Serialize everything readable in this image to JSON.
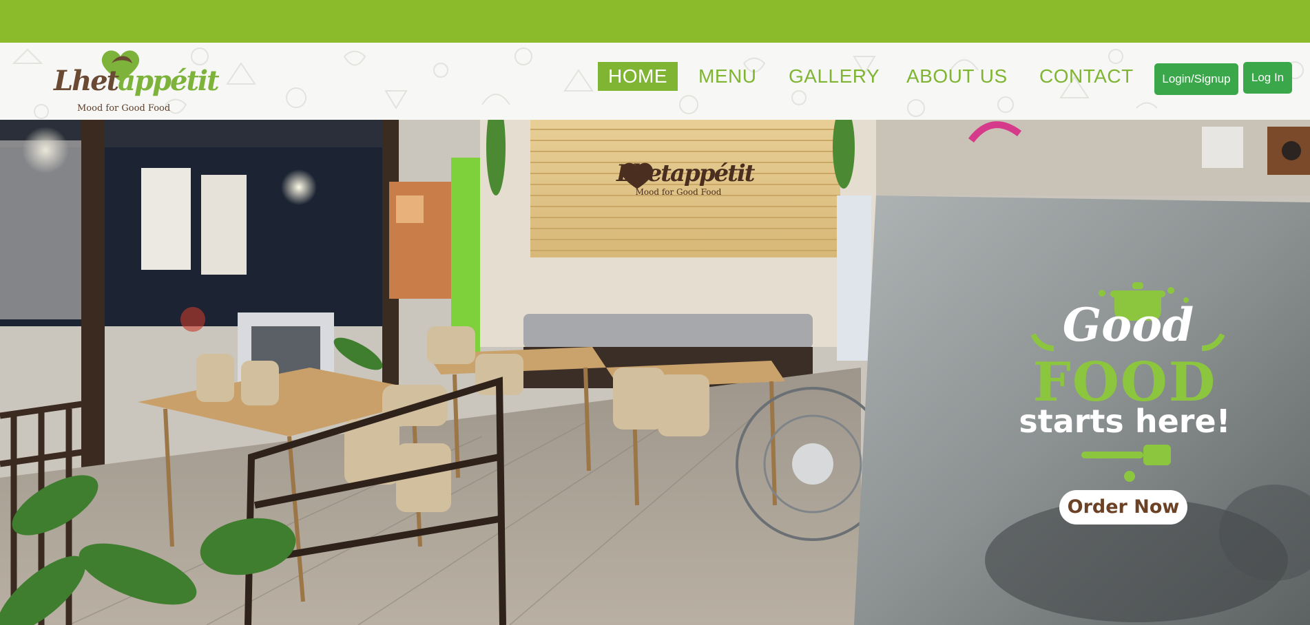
{
  "brand": {
    "name_part1": "Lhet",
    "name_part2": "appétit",
    "tagline": "Mood for Good Food"
  },
  "nav": {
    "items": [
      {
        "label": "HOME",
        "active": true
      },
      {
        "label": "MENU",
        "active": false
      },
      {
        "label": "GALLERY",
        "active": false
      },
      {
        "label": "ABOUT US",
        "active": false
      },
      {
        "label": "CONTACT",
        "active": false
      }
    ]
  },
  "auth": {
    "signup_label": "Login/Signup",
    "login_label": "Log In"
  },
  "hero": {
    "promo_line1": "Good",
    "promo_line2": "FOOD",
    "promo_line3": "starts here!",
    "cta_label": "Order Now"
  },
  "colors": {
    "top_band": "#8bba2a",
    "nav_green": "#7fb532",
    "button_green": "#3aa74a",
    "brand_brown": "#6b4a33",
    "cta_text": "#6b4226"
  }
}
